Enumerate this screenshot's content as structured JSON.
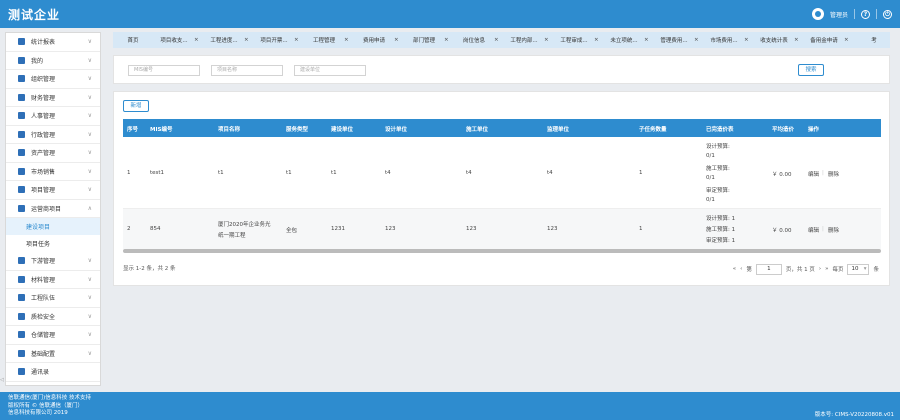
{
  "header": {
    "title": "测试企业",
    "user": "管理员",
    "help_icon": "question-icon",
    "logout_icon": "logout-icon"
  },
  "sidebar": {
    "items": [
      {
        "label": "统计报表",
        "icon": "bar-chart-icon"
      },
      {
        "label": "我的",
        "icon": "user-icon"
      },
      {
        "label": "组织管理",
        "icon": "org-icon"
      },
      {
        "label": "财务管理",
        "icon": "finance-icon"
      },
      {
        "label": "人事管理",
        "icon": "person-icon"
      },
      {
        "label": "行政管理",
        "icon": "admin-icon"
      },
      {
        "label": "资产管理",
        "icon": "asset-icon"
      },
      {
        "label": "市场销售",
        "icon": "cart-icon"
      },
      {
        "label": "项目管理",
        "icon": "grid-icon"
      },
      {
        "label": "运营商项目",
        "icon": "pie-icon",
        "expanded": true,
        "children": [
          "建设项目",
          "项目任务"
        ]
      },
      {
        "label": "下游管理",
        "icon": "downstream-icon"
      },
      {
        "label": "材料管理",
        "icon": "material-icon"
      },
      {
        "label": "工程队伍",
        "icon": "team-icon"
      },
      {
        "label": "质检安全",
        "icon": "shield-icon"
      },
      {
        "label": "仓储管理",
        "icon": "warehouse-icon"
      },
      {
        "label": "基础配置",
        "icon": "settings-icon"
      },
      {
        "label": "通讯录",
        "icon": "contacts-icon"
      }
    ]
  },
  "tabs": [
    "首页",
    "项目收支...",
    "工程进度...",
    "项目开票...",
    "工程管理",
    "费用申请",
    "部门管理",
    "岗位信息",
    "工程内部...",
    "工程审成...",
    "未立项统...",
    "管理费用...",
    "市场费用...",
    "收支统计表",
    "备用金申请",
    "考"
  ],
  "search": {
    "fields": [
      "MIS编号",
      "项目名称",
      "建设单位"
    ],
    "button": "搜索"
  },
  "toolbar": {
    "add": "新增"
  },
  "table": {
    "columns": [
      "序号",
      "MIS编号",
      "项目名称",
      "服务类型",
      "建设单位",
      "设计单位",
      "施工单位",
      "监理单位",
      "子任务数量",
      "已完造价表",
      "平均造价",
      "操作"
    ],
    "rows": [
      {
        "index": "1",
        "mis": "test1",
        "name": "t1",
        "service": "t1",
        "builder": "t1",
        "designer": "t4",
        "constructor": "t4",
        "supervisor": "t4",
        "subtasks": "1",
        "cost_lines": [
          "设计预算:",
          "0/1",
          "施工预算:",
          "0/1",
          "审定预算:",
          "0/1"
        ],
        "avg": "￥ 0.00",
        "edit": "编辑",
        "delete": "删除"
      },
      {
        "index": "2",
        "mis": "854",
        "name_lines": [
          "厦门2020年企业务光",
          "纸一期工程"
        ],
        "service": "全包",
        "builder": "1231",
        "designer": "123",
        "constructor": "123",
        "supervisor": "123",
        "subtasks": "1",
        "cost_lines": [
          "设计预算: 1",
          "施工预算: 1",
          "审定预算: 1"
        ],
        "avg": "￥ 0.00",
        "edit": "编辑",
        "delete": "删除"
      }
    ]
  },
  "pagination": {
    "info": "显示 1-2 条，共 2 条",
    "prev_first": "«",
    "prev": "‹",
    "page_label": "第",
    "page": "1",
    "page_total": "页，共 1 页",
    "next": "›",
    "next_last": "»",
    "per_page_label": "每页",
    "per_page": "10",
    "per_page_unit": "条"
  },
  "footer": {
    "line1": "信联通信(厦门)信息科技 技术支持",
    "line2": "版权所有 © 信联通信（厦门）",
    "line3": "信息科技有限公司 2019",
    "version": "版本号: CIMS-V20220808.v01"
  },
  "colors": {
    "primary": "#2e8ccf",
    "tabs_bg": "#d7e8f6",
    "edit": "#f0a830",
    "delete": "#e45050"
  }
}
